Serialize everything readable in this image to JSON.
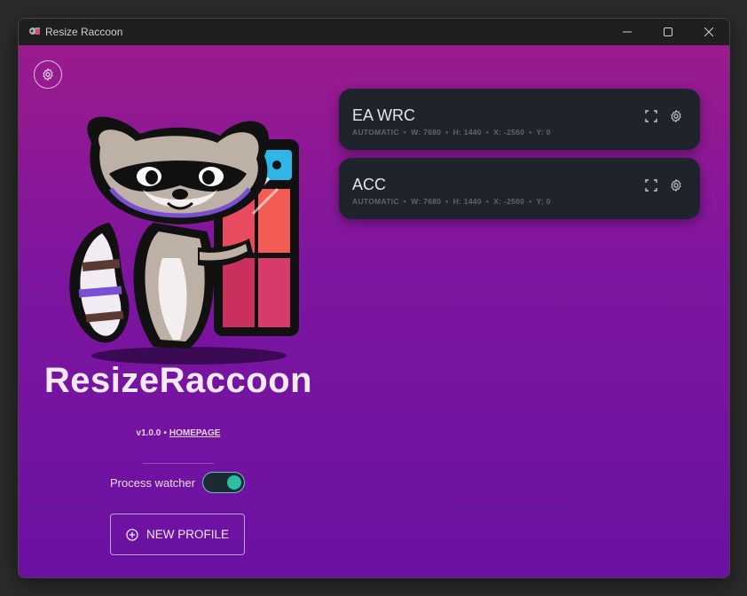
{
  "window": {
    "title": "Resize Raccoon"
  },
  "app": {
    "name": "ResizeRaccoon",
    "version": "v1.0.0",
    "separator": "•",
    "homepage_label": "HOMEPAGE"
  },
  "watcher": {
    "label": "Process watcher",
    "enabled": true
  },
  "new_profile": {
    "label": "NEW PROFILE"
  },
  "profiles": [
    {
      "name": "EA WRC",
      "mode": "AUTOMATIC",
      "w": "W: 7680",
      "h": "H: 1440",
      "x": "X: -2560",
      "y": "Y: 0"
    },
    {
      "name": "ACC",
      "mode": "AUTOMATIC",
      "w": "W: 7680",
      "h": "H: 1440",
      "x": "X: -2560",
      "y": "Y: 0"
    }
  ],
  "colors": {
    "gradient_top": "#9a1b8d",
    "gradient_bottom": "#6a11a2",
    "card_bg": "#1f232b",
    "toggle_on": "#2bbfa3"
  },
  "icons": [
    "app-icon",
    "minimize-icon",
    "maximize-icon",
    "close-icon",
    "gear-icon",
    "fullscreen-icon",
    "plus-circle-icon",
    "raccoon-mascot"
  ]
}
